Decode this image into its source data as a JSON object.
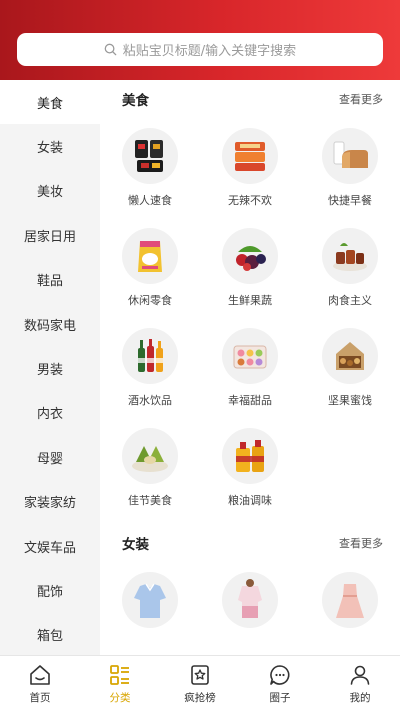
{
  "search": {
    "placeholder": "粘贴宝贝标题/输入关键字搜索"
  },
  "sidebar": {
    "items": [
      {
        "label": "美食",
        "active": true
      },
      {
        "label": "女装"
      },
      {
        "label": "美妆"
      },
      {
        "label": "居家日用"
      },
      {
        "label": "鞋品"
      },
      {
        "label": "数码家电"
      },
      {
        "label": "男装"
      },
      {
        "label": "内衣"
      },
      {
        "label": "母婴"
      },
      {
        "label": "家装家纺"
      },
      {
        "label": "文娱车品"
      },
      {
        "label": "配饰"
      },
      {
        "label": "箱包"
      }
    ]
  },
  "sections": [
    {
      "title": "美食",
      "more": "查看更多",
      "items": [
        {
          "label": "懒人速食",
          "icon": "instant-noodles-icon"
        },
        {
          "label": "无辣不欢",
          "icon": "spicy-snack-icon"
        },
        {
          "label": "快捷早餐",
          "icon": "bread-milk-icon"
        },
        {
          "label": "休闲零食",
          "icon": "snack-bag-icon"
        },
        {
          "label": "生鲜果蔬",
          "icon": "fruit-vegetable-icon"
        },
        {
          "label": "肉食主义",
          "icon": "braised-meat-icon"
        },
        {
          "label": "酒水饮品",
          "icon": "bottles-icon"
        },
        {
          "label": "幸福甜品",
          "icon": "dessert-box-icon"
        },
        {
          "label": "坚果蜜饯",
          "icon": "nuts-icon"
        },
        {
          "label": "佳节美食",
          "icon": "zongzi-icon"
        },
        {
          "label": "粮油调味",
          "icon": "cooking-oil-icon"
        }
      ]
    },
    {
      "title": "女装",
      "more": "查看更多",
      "items": [
        {
          "label": "",
          "icon": "blouse-icon"
        },
        {
          "label": "",
          "icon": "dress-top-icon"
        },
        {
          "label": "",
          "icon": "pink-dress-icon"
        }
      ]
    }
  ],
  "tabbar": [
    {
      "label": "首页",
      "icon": "home-icon"
    },
    {
      "label": "分类",
      "icon": "category-icon",
      "active": true
    },
    {
      "label": "疯抢榜",
      "icon": "ranking-icon"
    },
    {
      "label": "圈子",
      "icon": "chat-icon"
    },
    {
      "label": "我的",
      "icon": "user-icon"
    }
  ],
  "colors": {
    "header_start": "#a9171c",
    "header_end": "#ee3a3a",
    "tab_active": "#d8a500"
  }
}
